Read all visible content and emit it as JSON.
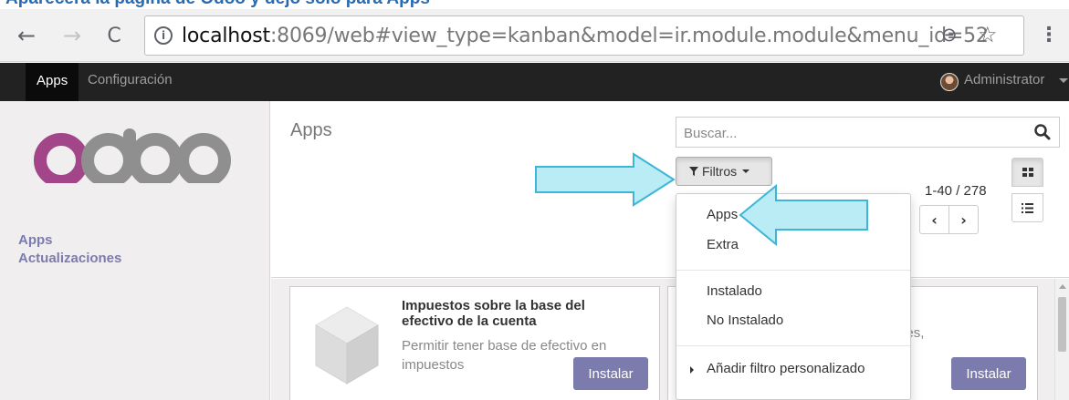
{
  "caption": "Aparecerá la página de Odoo y dejo solo para Apps",
  "browser": {
    "back_glyph": "←",
    "forward_glyph": "→",
    "reload_glyph": "C",
    "info_glyph": "i",
    "url_host": "localhost",
    "url_rest": ":8069/web#view_type=kanban&model=ir.module.module&menu_id=52",
    "zoom_glyph": "⊖",
    "star_glyph": "☆",
    "menu_glyph": "⋮"
  },
  "navbar": {
    "apps_label": "Apps",
    "config_label": "Configuración",
    "user_label": "Administrator"
  },
  "sidebar": {
    "items": [
      {
        "label": "Apps"
      },
      {
        "label": "Actualizaciones"
      }
    ]
  },
  "control_panel": {
    "title": "Apps",
    "search_placeholder": "Buscar...",
    "filter_label": "Filtros",
    "pager_value": "1-40 / 278",
    "pager_prev": "‹",
    "pager_next": "›"
  },
  "filter_menu": {
    "apps": "Apps",
    "extra": "Extra",
    "installed": "Instalado",
    "not_installed": "No Instalado",
    "add_custom": "Añadir filtro personalizado"
  },
  "kanban": {
    "cards": [
      {
        "title": "Impuestos sobre la base del efectivo de la cuenta",
        "description": "Permitir tener base de efectivo en impuestos",
        "button": "Instalar"
      },
      {
        "description_fragment": "idades,",
        "button": "Instalar"
      }
    ]
  },
  "colors": {
    "odoo_purple": "#7c7bad",
    "navbar_bg": "#222222",
    "arrow_fill": "#b9ecf5",
    "arrow_stroke": "#3fb5d6"
  }
}
